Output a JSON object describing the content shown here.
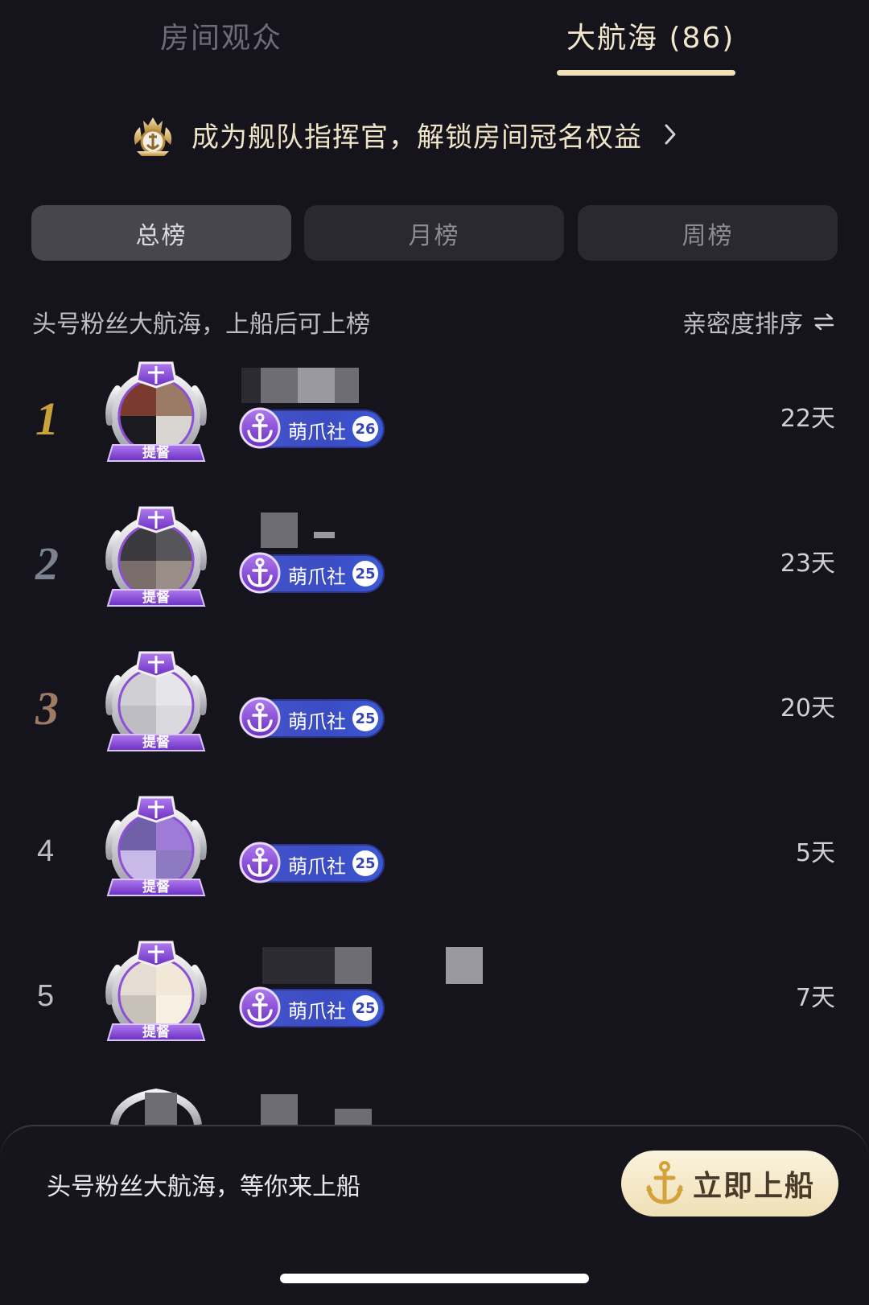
{
  "tabs": [
    {
      "label": "房间观众",
      "active": false
    },
    {
      "label": "大航海 (86)",
      "active": true
    }
  ],
  "banner": {
    "text": "成为舰队指挥官，解锁房间冠名权益"
  },
  "segments": [
    {
      "label": "总榜",
      "active": true
    },
    {
      "label": "月榜",
      "active": false
    },
    {
      "label": "周榜",
      "active": false
    }
  ],
  "list_header": {
    "hint": "头号粉丝大航海，上船后可上榜",
    "sort_label": "亲密度排序"
  },
  "ranking": [
    {
      "rank": "1",
      "badge_name": "萌爪社",
      "badge_level": "26",
      "days": "22天",
      "guard_label": "提督"
    },
    {
      "rank": "2",
      "badge_name": "萌爪社",
      "badge_level": "25",
      "days": "23天",
      "guard_label": "提督"
    },
    {
      "rank": "3",
      "badge_name": "萌爪社",
      "badge_level": "25",
      "days": "20天",
      "guard_label": "提督"
    },
    {
      "rank": "4",
      "badge_name": "萌爪社",
      "badge_level": "25",
      "days": "5天",
      "guard_label": "提督"
    },
    {
      "rank": "5",
      "badge_name": "萌爪社",
      "badge_level": "25",
      "days": "7天",
      "guard_label": "提督"
    }
  ],
  "bottom_bar": {
    "text": "头号粉丝大航海，等你来上船",
    "button_label": "立即上船"
  },
  "colors": {
    "background": "#15141c",
    "accent_gold": "#f1e1b9",
    "rank1": "#c9a13a",
    "rank2": "#7b8290",
    "rank3": "#9d7b64",
    "badge_blue": "#3f50c8",
    "guard_purple": "#8d4fd6"
  },
  "icons": {
    "banner": "commander-crest-icon",
    "chevron": "chevron-right-icon",
    "sort": "swap-arrows-icon",
    "badge": "anchor-icon",
    "button": "anchor-icon"
  }
}
